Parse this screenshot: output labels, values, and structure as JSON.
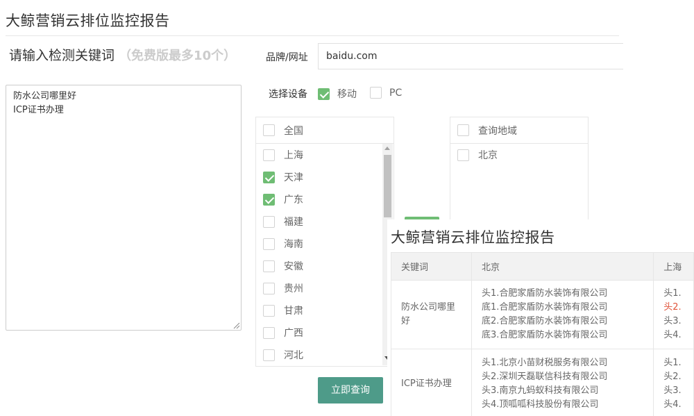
{
  "page": {
    "title": "大鲸营销云排位监控报告"
  },
  "keywords": {
    "label": "请输入检测关键词",
    "hint": "（免费版最多10个）",
    "lines": [
      "防水公司哪里好",
      "ICP证书办理"
    ]
  },
  "brand": {
    "label": "品牌/网址",
    "value": "baidu.com"
  },
  "device": {
    "label": "选择设备",
    "options": [
      {
        "label": "移动",
        "checked": true
      },
      {
        "label": "PC",
        "checked": false
      }
    ]
  },
  "regions": {
    "header": "全国",
    "items": [
      {
        "label": "上海",
        "checked": false
      },
      {
        "label": "天津",
        "checked": true
      },
      {
        "label": "广东",
        "checked": true
      },
      {
        "label": "福建",
        "checked": false
      },
      {
        "label": "海南",
        "checked": false
      },
      {
        "label": "安徽",
        "checked": false
      },
      {
        "label": "贵州",
        "checked": false
      },
      {
        "label": "甘肃",
        "checked": false
      },
      {
        "label": "广西",
        "checked": false
      },
      {
        "label": "河北",
        "checked": false
      }
    ]
  },
  "selected_regions": {
    "header": "查询地域",
    "items": [
      {
        "label": "北京",
        "checked": false
      }
    ]
  },
  "query_button": {
    "label": "立即查询"
  },
  "report": {
    "title": "大鲸营销云排位监控报告",
    "columns": [
      "关键词",
      "北京",
      "上海"
    ],
    "rows": [
      {
        "keyword": "防水公司哪里好",
        "beijing": [
          "头1.合肥家盾防水装饰有限公司",
          "底1.合肥家盾防水装饰有限公司",
          "底2.合肥家盾防水装饰有限公司",
          "底3.合肥家盾防水装饰有限公司"
        ],
        "shanghai": [
          "头1.",
          "头2.",
          "头3.",
          "头4."
        ],
        "shanghai_highlight": [
          false,
          true,
          false,
          false
        ]
      },
      {
        "keyword": "ICP证书办理",
        "beijing": [
          "头1.北京小苗财税服务有限公司",
          "头2.深圳天磊联信科技有限公司",
          "头3.南京九蚂蚁科技有限公司",
          "头4.顶呱呱科技股份有限公司"
        ],
        "shanghai": [
          "头1.",
          "头2.",
          "头3.",
          "头4."
        ],
        "shanghai_highlight": [
          false,
          false,
          false,
          false
        ]
      }
    ]
  },
  "colors": {
    "accent_green": "#6fbd74",
    "button_teal": "#4e9b89",
    "highlight_red": "#e0533a"
  }
}
